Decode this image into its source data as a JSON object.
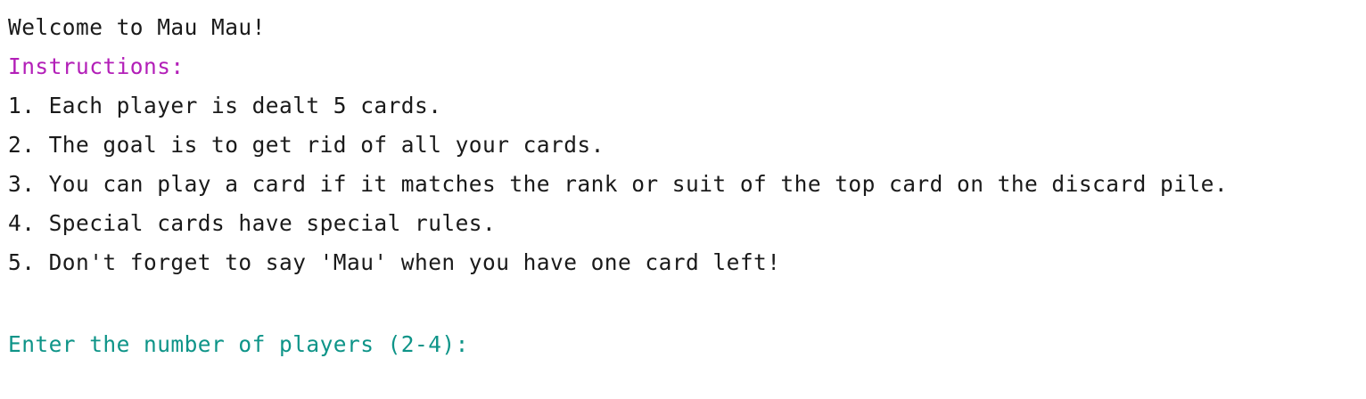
{
  "console": {
    "welcome": "Welcome to Mau Mau!",
    "instructions_header": "Instructions:",
    "instructions": [
      "1. Each player is dealt 5 cards.",
      "2. The goal is to get rid of all your cards.",
      "3. You can play a card if it matches the rank or suit of the top card on the discard pile.",
      "4. Special cards have special rules.",
      "5. Don't forget to say 'Mau' when you have one card left!"
    ],
    "prompt": "Enter the number of players (2-4): ",
    "input_value": ""
  },
  "colors": {
    "text": "#1a1a1a",
    "header": "#b31fb8",
    "prompt": "#0e9488",
    "background": "#ffffff"
  }
}
